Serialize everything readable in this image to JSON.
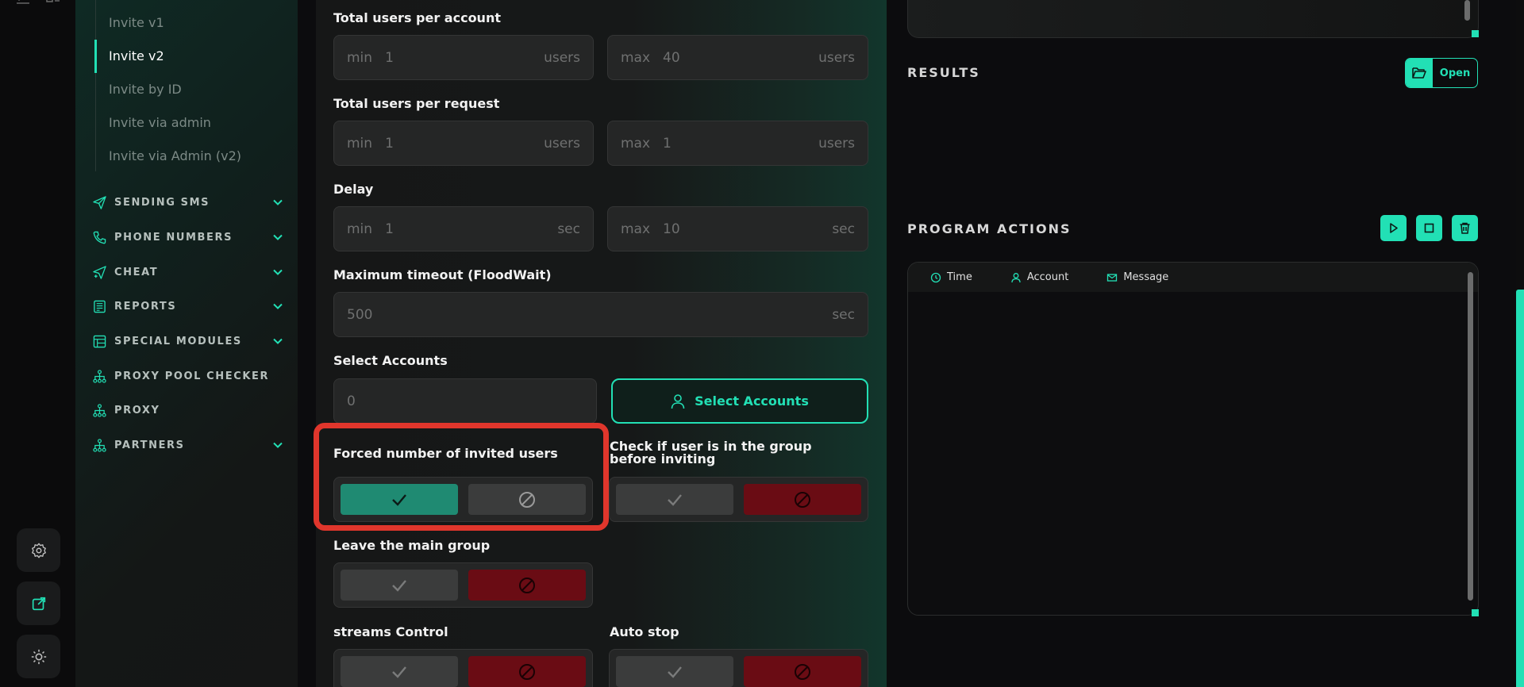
{
  "sidebar": {
    "sub_items": [
      "Invite v1",
      "Invite v2",
      "Invite by ID",
      "Invite via admin",
      "Invite via Admin (v2)"
    ],
    "active_sub": "Invite v2",
    "nav": [
      {
        "label": "SENDING SMS",
        "icon": "send-icon",
        "has_chevron": true
      },
      {
        "label": "PHONE NUMBERS",
        "icon": "phone-icon",
        "has_chevron": true
      },
      {
        "label": "CHEAT",
        "icon": "send-plus-icon",
        "has_chevron": true
      },
      {
        "label": "REPORTS",
        "icon": "report-icon",
        "has_chevron": true
      },
      {
        "label": "SPECIAL MODULES",
        "icon": "modules-icon",
        "has_chevron": true
      },
      {
        "label": "PROXY POOL CHECKER",
        "icon": "network-icon",
        "has_chevron": false
      },
      {
        "label": "PROXY",
        "icon": "network-icon",
        "has_chevron": false
      },
      {
        "label": "PARTNERS",
        "icon": "network-icon",
        "has_chevron": true
      }
    ]
  },
  "form": {
    "users_per_account": {
      "label": "Total users per account",
      "min_prefix": "min",
      "min_value": "1",
      "min_suffix": "users",
      "max_prefix": "max",
      "max_value": "40",
      "max_suffix": "users"
    },
    "users_per_request": {
      "label": "Total users per request",
      "min_prefix": "min",
      "min_value": "1",
      "min_suffix": "users",
      "max_prefix": "max",
      "max_value": "1",
      "max_suffix": "users"
    },
    "delay": {
      "label": "Delay",
      "min_prefix": "min",
      "min_value": "1",
      "min_suffix": "sec",
      "max_prefix": "max",
      "max_value": "10",
      "max_suffix": "sec"
    },
    "timeout": {
      "label": "Maximum timeout (FloodWait)",
      "value": "500",
      "suffix": "sec"
    },
    "accounts": {
      "label": "Select Accounts",
      "value": "0",
      "button": "Select Accounts"
    },
    "toggles": {
      "forced": {
        "label": "Forced number of invited users",
        "state": "yes"
      },
      "check_group": {
        "label": "Check if user is in the group before inviting",
        "state": "no"
      },
      "leave_group": {
        "label": "Leave the main group",
        "state": "no"
      },
      "streams": {
        "label": "streams Control",
        "state": "no"
      },
      "auto_stop": {
        "label": "Auto stop",
        "state": "no"
      }
    }
  },
  "results": {
    "title": "RESULTS",
    "open_label": "Open"
  },
  "program_actions": {
    "title": "PROGRAM ACTIONS",
    "columns": [
      "Time",
      "Account",
      "Message"
    ]
  },
  "colors": {
    "accent": "#22e0b5",
    "yes_on": "#1f8a72",
    "no_on": "#6a0c14",
    "highlight": "#e0362c"
  }
}
